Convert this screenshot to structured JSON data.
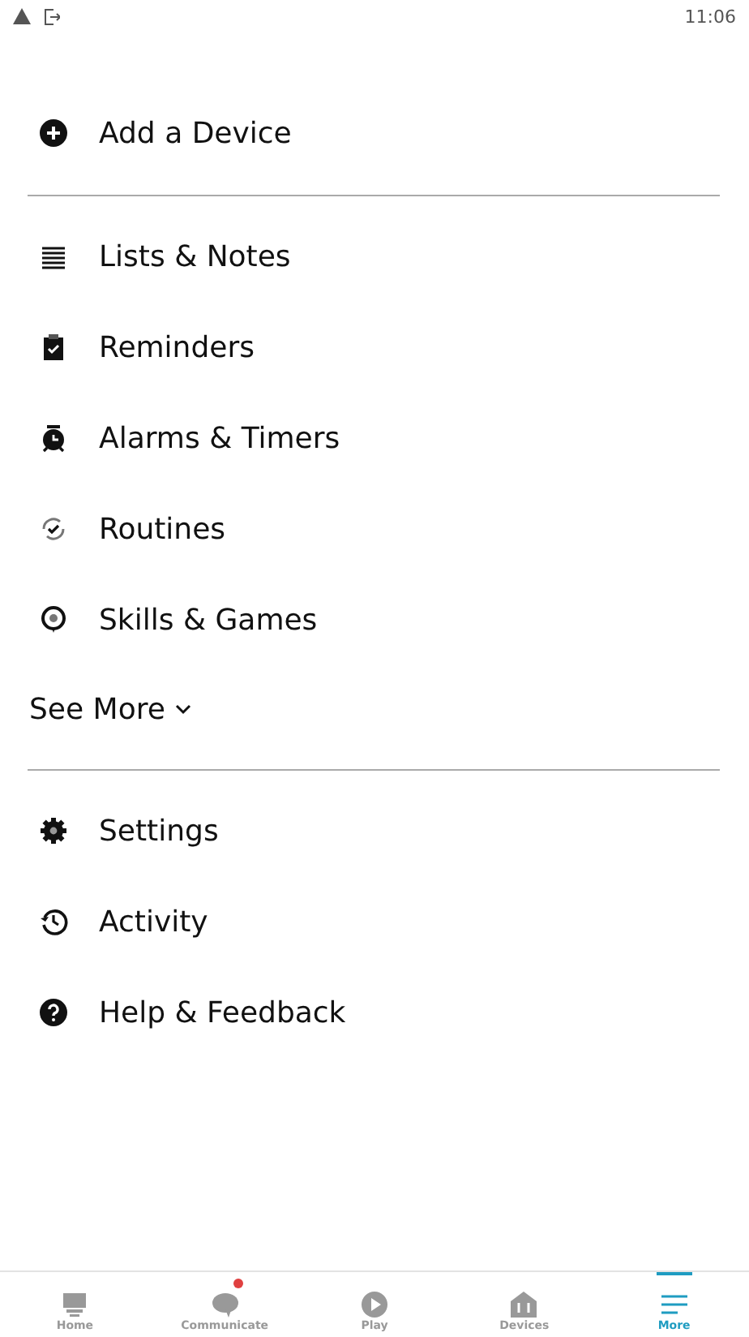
{
  "status_bar": {
    "time": "11:06"
  },
  "sections": [
    {
      "items": [
        {
          "label": "Add a Device"
        }
      ]
    },
    {
      "items": [
        {
          "label": "Lists & Notes"
        },
        {
          "label": "Reminders"
        },
        {
          "label": "Alarms & Timers"
        },
        {
          "label": "Routines"
        },
        {
          "label": "Skills & Games"
        }
      ],
      "see_more": {
        "label": "See More",
        "expanded": false
      }
    },
    {
      "items": [
        {
          "label": "Settings"
        },
        {
          "label": "Activity"
        },
        {
          "label": "Help & Feedback"
        }
      ]
    }
  ],
  "bottom_nav": [
    {
      "label": "Home",
      "selected": false,
      "badge": false
    },
    {
      "label": "Communicate",
      "selected": false,
      "badge": true
    },
    {
      "label": "Play",
      "selected": false,
      "badge": false
    },
    {
      "label": "Devices",
      "selected": false,
      "badge": false
    },
    {
      "label": "More",
      "selected": true,
      "badge": false
    }
  ]
}
